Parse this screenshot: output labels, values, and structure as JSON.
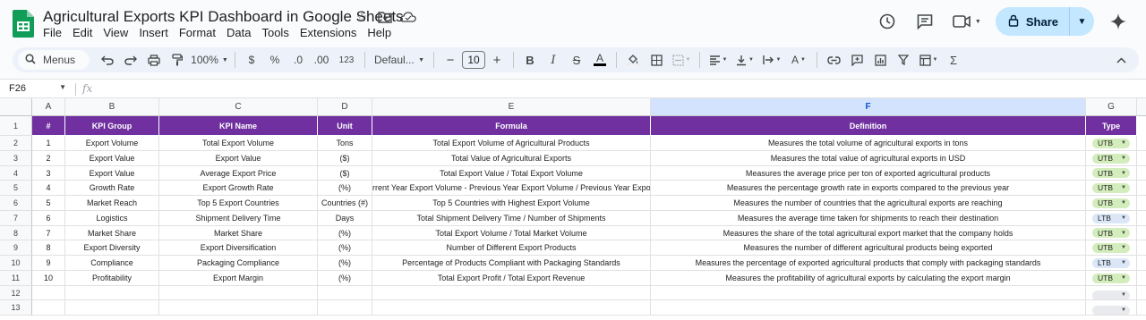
{
  "app": {
    "title": "Agricultural Exports KPI Dashboard in Google Sheets",
    "menu": [
      "File",
      "Edit",
      "View",
      "Insert",
      "Format",
      "Data",
      "Tools",
      "Extensions",
      "Help"
    ],
    "share_label": "Share"
  },
  "toolbar": {
    "search_label": "Menus",
    "zoom": "100%",
    "currency": "$",
    "percent": "%",
    "dec_decrease": ".0",
    "dec_increase": ".00",
    "number_format": "123",
    "font": "Defaul...",
    "font_size": "10",
    "minus": "−",
    "plus": "+",
    "bold": "B",
    "sum": "Σ"
  },
  "formula_bar": {
    "cell_ref": "F26",
    "fx": "fx",
    "value": ""
  },
  "columns": [
    "A",
    "B",
    "C",
    "D",
    "E",
    "F",
    "G"
  ],
  "header": [
    "#",
    "KPI Group",
    "KPI Name",
    "Unit",
    "Formula",
    "Definition",
    "Type"
  ],
  "rows": [
    {
      "num": "1",
      "group": "Export Volume",
      "name": "Total Export Volume",
      "unit": "Tons",
      "formula": "Total Export Volume of Agricultural Products",
      "definition": "Measures the total volume of agricultural exports in tons",
      "type": "UTB"
    },
    {
      "num": "2",
      "group": "Export Value",
      "name": "Export Value",
      "unit": "($)",
      "formula": "Total Value of Agricultural Exports",
      "definition": "Measures the total value of agricultural exports in USD",
      "type": "UTB"
    },
    {
      "num": "3",
      "group": "Export Value",
      "name": "Average Export Price",
      "unit": "($)",
      "formula": "Total Export Value / Total Export Volume",
      "definition": "Measures the average price per ton of exported agricultural products",
      "type": "UTB"
    },
    {
      "num": "4",
      "group": "Growth Rate",
      "name": "Export Growth Rate",
      "unit": "(%)",
      "formula": "rrent Year Export Volume - Previous Year Export Volume / Previous Year Export Volu",
      "definition": "Measures the percentage growth rate in exports compared to the previous year",
      "type": "UTB"
    },
    {
      "num": "5",
      "group": "Market Reach",
      "name": "Top 5 Export Countries",
      "unit": "Countries (#)",
      "formula": "Top 5 Countries with Highest Export Volume",
      "definition": "Measures the number of countries that the agricultural exports are reaching",
      "type": "UTB"
    },
    {
      "num": "6",
      "group": "Logistics",
      "name": "Shipment Delivery Time",
      "unit": "Days",
      "formula": "Total Shipment Delivery Time / Number of Shipments",
      "definition": "Measures the average time taken for shipments to reach their destination",
      "type": "LTB"
    },
    {
      "num": "7",
      "group": "Market Share",
      "name": "Market Share",
      "unit": "(%)",
      "formula": "Total Export Volume / Total Market Volume",
      "definition": "Measures the share of the total agricultural export market that the company holds",
      "type": "UTB"
    },
    {
      "num": "8",
      "group": "Export Diversity",
      "name": "Export Diversification",
      "unit": "(%)",
      "formula": "Number of Different Export Products",
      "definition": "Measures the number of different agricultural products being exported",
      "type": "UTB"
    },
    {
      "num": "9",
      "group": "Compliance",
      "name": "Packaging Compliance",
      "unit": "(%)",
      "formula": "Percentage of Products Compliant with Packaging Standards",
      "definition": "Measures the percentage of exported agricultural products that comply with packaging standards",
      "type": "LTB"
    },
    {
      "num": "10",
      "group": "Profitability",
      "name": "Export Margin",
      "unit": "(%)",
      "formula": "Total Export Profit / Total Export Revenue",
      "definition": "Measures the profitability of agricultural exports by calculating the export margin",
      "type": "UTB"
    },
    {
      "num": "",
      "group": "",
      "name": "",
      "unit": "",
      "formula": "",
      "definition": "",
      "type": ""
    },
    {
      "num": "",
      "group": "",
      "name": "",
      "unit": "",
      "formula": "",
      "definition": "",
      "type": ""
    }
  ],
  "row_numbers": [
    "1",
    "2",
    "3",
    "4",
    "5",
    "6",
    "7",
    "8",
    "9",
    "10",
    "11",
    "12",
    "13"
  ],
  "colors": {
    "header_bg": "#7030a0",
    "utb_chip": "#d4edbc",
    "ltb_chip": "#dbe7f7",
    "selected_col": "#d3e3fd"
  }
}
